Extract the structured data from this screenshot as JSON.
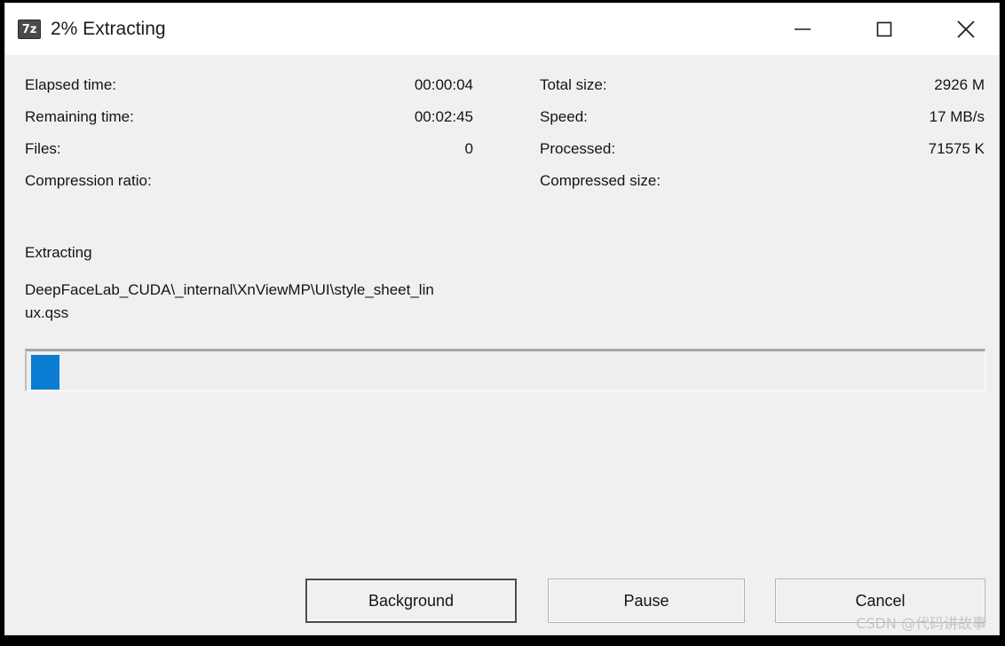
{
  "window": {
    "icon_name": "seven-zip-icon",
    "icon_glyph": "7z",
    "title": "2% Extracting",
    "progress_percent": 2,
    "controls": {
      "minimize": "Minimize",
      "maximize": "Maximize",
      "close": "Close"
    }
  },
  "stats": {
    "left": [
      {
        "label": "Elapsed time:",
        "value": "00:00:04"
      },
      {
        "label": "Remaining time:",
        "value": "00:02:45"
      },
      {
        "label": "Files:",
        "value": "0"
      },
      {
        "label": "Compression ratio:",
        "value": ""
      }
    ],
    "right": [
      {
        "label": "Total size:",
        "value": "2926 M"
      },
      {
        "label": "Speed:",
        "value": "17 MB/s"
      },
      {
        "label": "Processed:",
        "value": "71575 K"
      },
      {
        "label": "Compressed size:",
        "value": ""
      }
    ]
  },
  "operation": {
    "label": "Extracting",
    "path": "DeepFaceLab_CUDA\\_internal\\XnViewMP\\UI\\style_sheet_linux.qss"
  },
  "progress": {
    "percent": 2,
    "fill_color": "#0a7cd1",
    "track_color": "#eeeeee"
  },
  "buttons": {
    "background": "Background",
    "pause": "Pause",
    "cancel": "Cancel"
  },
  "watermark": "CSDN @代码讲故事",
  "colors": {
    "titlebar_bg": "#ffffff",
    "dialog_bg": "#f0f0f0",
    "text": "#141414",
    "accent": "#0a7cd1"
  }
}
